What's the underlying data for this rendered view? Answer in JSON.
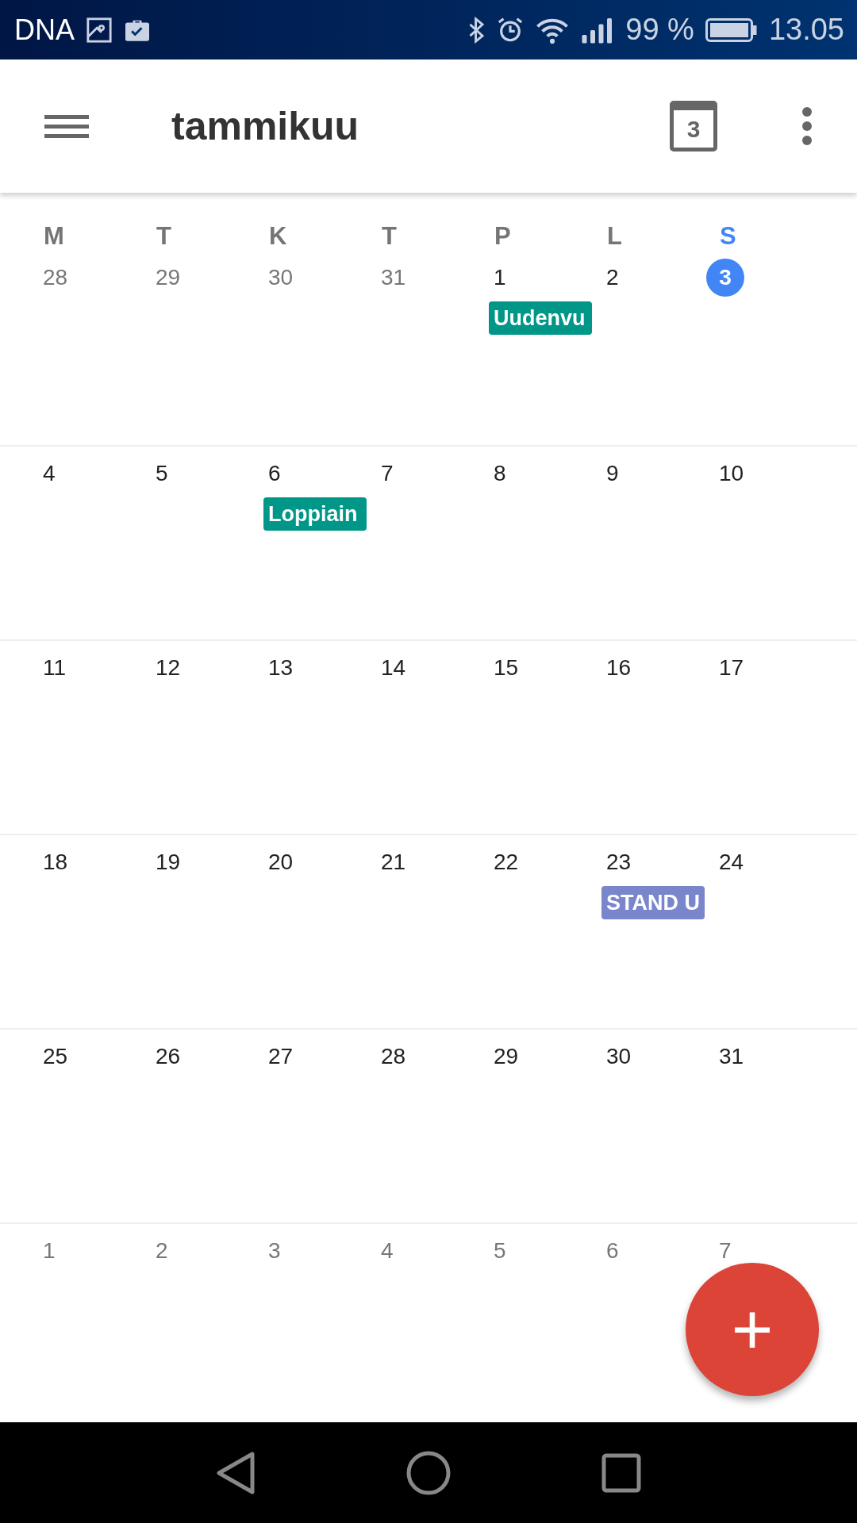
{
  "status_bar": {
    "carrier": "DNA",
    "battery_text": "99 %",
    "time": "13.05"
  },
  "app_bar": {
    "title": "tammikuu",
    "today_icon_day": "3"
  },
  "weekdays": [
    {
      "label": "M",
      "selected": false
    },
    {
      "label": "T",
      "selected": false
    },
    {
      "label": "K",
      "selected": false
    },
    {
      "label": "T",
      "selected": false
    },
    {
      "label": "P",
      "selected": false
    },
    {
      "label": "L",
      "selected": false
    },
    {
      "label": "S",
      "selected": true
    }
  ],
  "weeks": [
    {
      "days": [
        {
          "number": "28",
          "in_month": false,
          "today": false
        },
        {
          "number": "29",
          "in_month": false,
          "today": false
        },
        {
          "number": "30",
          "in_month": false,
          "today": false
        },
        {
          "number": "31",
          "in_month": false,
          "today": false
        },
        {
          "number": "1",
          "in_month": true,
          "today": false,
          "events": [
            {
              "title": "Uudenvu",
              "color": "#009688"
            }
          ]
        },
        {
          "number": "2",
          "in_month": true,
          "today": false
        },
        {
          "number": "3",
          "in_month": true,
          "today": true
        }
      ]
    },
    {
      "days": [
        {
          "number": "4",
          "in_month": true,
          "today": false
        },
        {
          "number": "5",
          "in_month": true,
          "today": false
        },
        {
          "number": "6",
          "in_month": true,
          "today": false,
          "events": [
            {
              "title": "Loppiain",
              "color": "#009688"
            }
          ]
        },
        {
          "number": "7",
          "in_month": true,
          "today": false
        },
        {
          "number": "8",
          "in_month": true,
          "today": false
        },
        {
          "number": "9",
          "in_month": true,
          "today": false
        },
        {
          "number": "10",
          "in_month": true,
          "today": false
        }
      ]
    },
    {
      "days": [
        {
          "number": "11",
          "in_month": true,
          "today": false
        },
        {
          "number": "12",
          "in_month": true,
          "today": false
        },
        {
          "number": "13",
          "in_month": true,
          "today": false
        },
        {
          "number": "14",
          "in_month": true,
          "today": false
        },
        {
          "number": "15",
          "in_month": true,
          "today": false
        },
        {
          "number": "16",
          "in_month": true,
          "today": false
        },
        {
          "number": "17",
          "in_month": true,
          "today": false
        }
      ]
    },
    {
      "days": [
        {
          "number": "18",
          "in_month": true,
          "today": false
        },
        {
          "number": "19",
          "in_month": true,
          "today": false
        },
        {
          "number": "20",
          "in_month": true,
          "today": false
        },
        {
          "number": "21",
          "in_month": true,
          "today": false
        },
        {
          "number": "22",
          "in_month": true,
          "today": false
        },
        {
          "number": "23",
          "in_month": true,
          "today": false,
          "events": [
            {
              "title": "STAND U",
              "color": "#7986cb"
            }
          ]
        },
        {
          "number": "24",
          "in_month": true,
          "today": false
        }
      ]
    },
    {
      "days": [
        {
          "number": "25",
          "in_month": true,
          "today": false
        },
        {
          "number": "26",
          "in_month": true,
          "today": false
        },
        {
          "number": "27",
          "in_month": true,
          "today": false
        },
        {
          "number": "28",
          "in_month": true,
          "today": false
        },
        {
          "number": "29",
          "in_month": true,
          "today": false
        },
        {
          "number": "30",
          "in_month": true,
          "today": false
        },
        {
          "number": "31",
          "in_month": true,
          "today": false
        }
      ]
    },
    {
      "days": [
        {
          "number": "1",
          "in_month": false,
          "today": false
        },
        {
          "number": "2",
          "in_month": false,
          "today": false
        },
        {
          "number": "3",
          "in_month": false,
          "today": false
        },
        {
          "number": "4",
          "in_month": false,
          "today": false
        },
        {
          "number": "5",
          "in_month": false,
          "today": false
        },
        {
          "number": "6",
          "in_month": false,
          "today": false
        },
        {
          "number": "7",
          "in_month": false,
          "today": false
        }
      ]
    }
  ],
  "fab": {
    "label": "+"
  }
}
